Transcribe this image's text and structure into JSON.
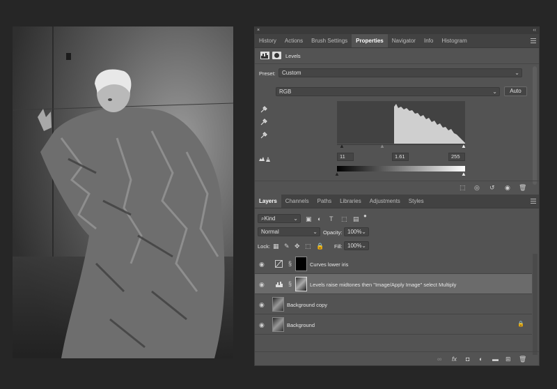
{
  "properties_panel": {
    "tabs": [
      "History",
      "Actions",
      "Brush Settings",
      "Properties",
      "Navigator",
      "Info",
      "Histogram"
    ],
    "active_tab": "Properties",
    "adjustment_title": "Levels",
    "preset_label": "Preset:",
    "preset_value": "Custom",
    "channel_value": "RGB",
    "auto_label": "Auto",
    "input_black": "11",
    "input_gamma": "1.61",
    "input_white": "255"
  },
  "layers_panel": {
    "tabs": [
      "Layers",
      "Channels",
      "Paths",
      "Libraries",
      "Adjustments",
      "Styles"
    ],
    "active_tab": "Layers",
    "filter_kind": "Kind",
    "blend_mode": "Normal",
    "opacity_label": "Opacity:",
    "opacity_value": "100%",
    "lock_label": "Lock:",
    "fill_label": "Fill:",
    "fill_value": "100%",
    "layers": [
      {
        "name": "Curves lower iris",
        "type": "curves",
        "selected": false
      },
      {
        "name": "Levels raise midtones then \"Image/Apply Image\" select Multiply",
        "type": "levels",
        "selected": true
      },
      {
        "name": "Background copy",
        "type": "pixel",
        "selected": false
      },
      {
        "name": "Background",
        "type": "pixel",
        "selected": false,
        "locked": true
      }
    ]
  },
  "colors": {
    "panel": "#535353",
    "tabbar": "#424242",
    "selected_row": "#6b6b6b",
    "app_bg": "#262626"
  }
}
